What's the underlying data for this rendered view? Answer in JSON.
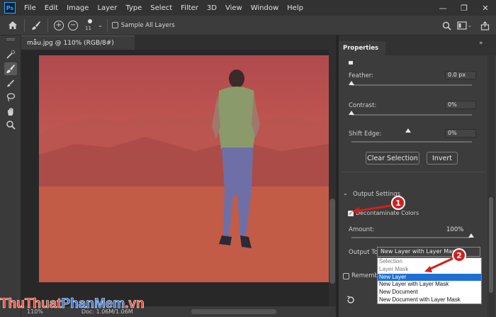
{
  "menubar": {
    "logo": "Ps",
    "items": [
      "File",
      "Edit",
      "Image",
      "Layer",
      "Type",
      "Select",
      "Filter",
      "3D",
      "View",
      "Window",
      "Help"
    ],
    "controls": [
      "—",
      "❐",
      "✕"
    ]
  },
  "options_bar": {
    "brush_size": "11",
    "sample_all_layers_label": "Sample All Layers"
  },
  "document": {
    "tab_title": "mẫu.jpg @ 110% (RGB/8#)",
    "status_zoom": "110%",
    "status_doc": "Doc: 1.06M/1.06M"
  },
  "properties": {
    "tab_label": "Properties",
    "feather_label": "Feather:",
    "feather_value": "0.0 px",
    "contrast_label": "Contrast:",
    "contrast_value": "0%",
    "shift_edge_label": "Shift Edge:",
    "shift_edge_value": "0%",
    "clear_selection_label": "Clear Selection",
    "invert_label": "Invert",
    "output_settings_label": "Output Settings",
    "decontaminate_label": "Decontaminate Colors",
    "decontaminate_checked": true,
    "amount_label": "Amount:",
    "amount_value": "100%",
    "output_to_label": "Output To:",
    "output_to_selected": "New Layer with Layer Mask",
    "remember_label": "Remember S",
    "output_options": [
      {
        "label": "Selection",
        "state": "disabled"
      },
      {
        "label": "Layer Mask",
        "state": "disabled"
      },
      {
        "label": "New Layer",
        "state": "selected"
      },
      {
        "label": "New Layer with Layer Mask",
        "state": "normal"
      },
      {
        "label": "New Document",
        "state": "normal"
      },
      {
        "label": "New Document with Layer Mask",
        "state": "normal"
      }
    ]
  },
  "callouts": [
    "1",
    "2"
  ],
  "watermark": {
    "part1": "ThuThuat",
    "part2": "PhanMem",
    "part3": ".vn",
    "color1": "#e8412b",
    "color2": "#2b6fd6"
  }
}
